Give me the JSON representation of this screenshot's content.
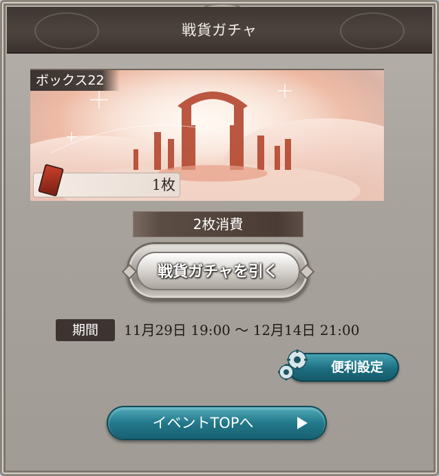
{
  "header": {
    "title": "戦貨ガチャ"
  },
  "banner": {
    "box_label": "ボックス22",
    "ticket_count": "1枚",
    "icon": "ticket-icon"
  },
  "cost": {
    "label": "2枚消費"
  },
  "gacha_button": {
    "label": "戦貨ガチャを引く"
  },
  "period": {
    "badge": "期間",
    "text": "11月29日 19:00 ～ 12月14日 21:00"
  },
  "settings_button": {
    "label": "便利設定",
    "icon": "gear-icon"
  },
  "event_button": {
    "label": "イベントTOPへ",
    "icon": "play-icon"
  },
  "colors": {
    "teal": "#1c6e80",
    "dark_brown": "#3d3431",
    "panel": "#aaa49e"
  }
}
